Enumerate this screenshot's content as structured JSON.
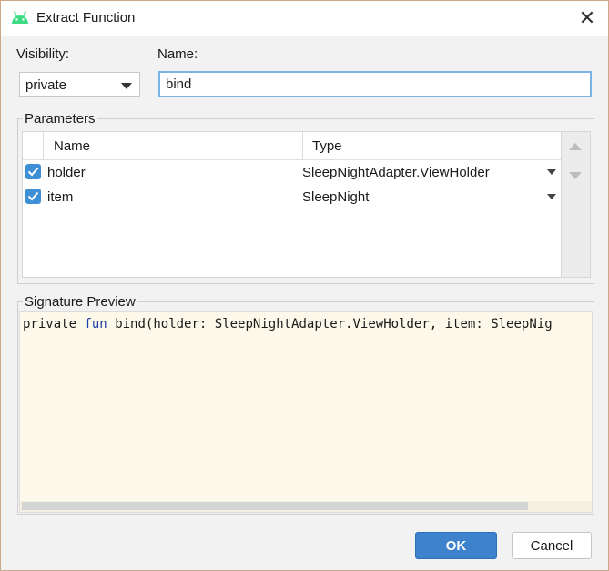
{
  "window": {
    "title": "Extract Function",
    "close_glyph": "✕"
  },
  "colors": {
    "accent": "#3d82cc",
    "checkbox": "#3d8fd6",
    "keyword": "#1e3ea8",
    "preview_bg": "#fcf9ea"
  },
  "icons": {
    "app": "android-icon",
    "close": "close-icon"
  },
  "visibility": {
    "label": "Visibility:",
    "value": "private"
  },
  "name": {
    "label": "Name:",
    "value": "bind"
  },
  "parameters": {
    "title": "Parameters",
    "headers": {
      "name": "Name",
      "type": "Type"
    },
    "rows": [
      {
        "checked": true,
        "name": "holder",
        "type": "SleepNightAdapter.ViewHolder"
      },
      {
        "checked": true,
        "name": "item",
        "type": "SleepNight"
      }
    ]
  },
  "signature": {
    "title": "Signature Preview",
    "kw1": "private",
    "kw2": "fun",
    "rest": "bind(holder: SleepNightAdapter.ViewHolder, item: SleepNig"
  },
  "buttons": {
    "ok": "OK",
    "cancel": "Cancel"
  }
}
